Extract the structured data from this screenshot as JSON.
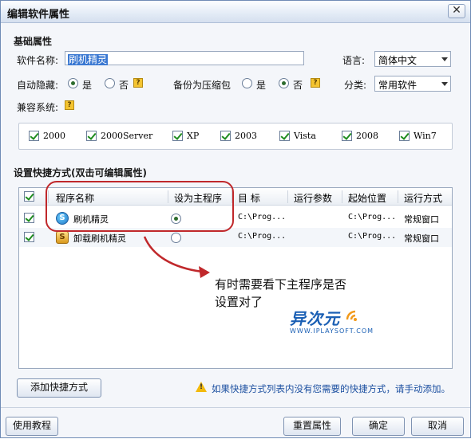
{
  "window": {
    "title": "编辑软件属性",
    "close_glyph": "✕"
  },
  "basic": {
    "section_title": "基础属性",
    "name_label": "软件名称:",
    "name_value": "刷机精灵",
    "language_label": "语言:",
    "language_value": "简体中文",
    "autohide_label": "自动隐藏:",
    "autohide_yes": "是",
    "autohide_no": "否",
    "autohide_selected": "是",
    "backup_label": "备份为压缩包",
    "backup_yes": "是",
    "backup_no": "否",
    "backup_selected": "否",
    "category_label": "分类:",
    "category_value": "常用软件",
    "compat_label": "兼容系统:",
    "help_glyph": "?"
  },
  "compat": [
    {
      "label": "2000",
      "checked": true
    },
    {
      "label": "2000Server",
      "checked": true
    },
    {
      "label": "XP",
      "checked": true
    },
    {
      "label": "2003",
      "checked": true
    },
    {
      "label": "Vista",
      "checked": true
    },
    {
      "label": "2008",
      "checked": true
    },
    {
      "label": "Win7",
      "checked": true
    }
  ],
  "shortcuts": {
    "section_title": "设置快捷方式(双击可编辑属性)",
    "columns": [
      "程序名称",
      "设为主程序",
      "目 标",
      "运行参数",
      "起始位置",
      "运行方式"
    ],
    "rows": [
      {
        "name": "刷机精灵",
        "main": true,
        "target": "C:\\Prog...",
        "args": "",
        "start": "C:\\Prog...",
        "mode": "常规窗口",
        "checked": true,
        "icon": "shuaji-app-icon",
        "icon_glyph": "S"
      },
      {
        "name": "卸载刷机精灵",
        "main": false,
        "target": "C:\\Prog...",
        "args": "",
        "start": "C:\\Prog...",
        "mode": "常规窗口",
        "checked": true,
        "icon": "uninstall-icon",
        "icon_glyph": "S"
      }
    ]
  },
  "annotation": {
    "line1": "有时需要看下主程序是否",
    "line2": "设置对了"
  },
  "logo": {
    "cn": "异次元",
    "en": "WWW.IPLAYSOFT.COM"
  },
  "buttons": {
    "add_shortcut": "添加快捷方式",
    "tutorial": "使用教程",
    "reset": "重置属性",
    "ok": "确定",
    "cancel": "取消"
  },
  "hint": "如果快捷方式列表内没有您需要的快捷方式，请手动添加。",
  "colors": {
    "accent": "#c0282b",
    "link": "#1b4fa0",
    "brand": "#1a5fb4"
  }
}
